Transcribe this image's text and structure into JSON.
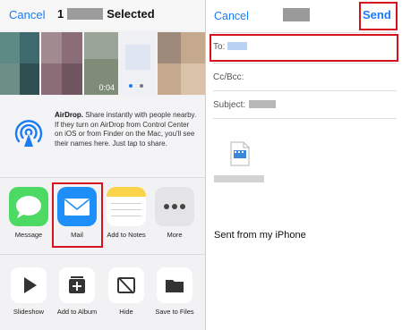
{
  "share_sheet": {
    "cancel_label": "Cancel",
    "title_prefix": "1",
    "title_suffix": "Selected",
    "video_duration": "0:04",
    "airdrop": {
      "title": "AirDrop.",
      "description": "Share instantly with people nearby. If they turn on AirDrop from Control Center on iOS or from Finder on the Mac, you'll see their names here. Just tap to share."
    },
    "apps": [
      {
        "label": "Message",
        "icon": "messages-icon",
        "color": "#4cd964"
      },
      {
        "label": "Mail",
        "icon": "mail-icon",
        "color": "#1e8ef8"
      },
      {
        "label": "Add to Notes",
        "icon": "notes-icon",
        "color": "#fbd34a"
      },
      {
        "label": "More",
        "icon": "more-icon",
        "color": "#e4e4e6"
      }
    ],
    "actions": [
      {
        "label": "Slideshow",
        "icon": "play-icon"
      },
      {
        "label": "Add to Album",
        "icon": "add-to-album-icon"
      },
      {
        "label": "Hide",
        "icon": "hide-icon"
      },
      {
        "label": "Save to Files",
        "icon": "folder-icon"
      }
    ]
  },
  "compose": {
    "cancel_label": "Cancel",
    "send_label": "Send",
    "to_label": "To:",
    "cc_label": "Cc/Bcc:",
    "subject_label": "Subject:",
    "attachment_icon": "video-file-icon",
    "body_text": "Sent from my iPhone"
  },
  "colors": {
    "accent": "#1a7cf5",
    "highlight": "#d3141f"
  }
}
